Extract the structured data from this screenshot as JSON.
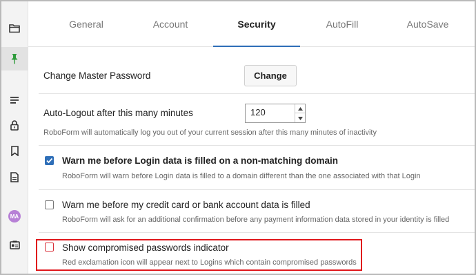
{
  "sidebar": {
    "items": [
      {
        "icon": "folder-icon"
      },
      {
        "icon": "pin-icon",
        "active": true
      },
      {
        "icon": "list-icon"
      },
      {
        "icon": "lock-icon"
      },
      {
        "icon": "bookmark-icon"
      },
      {
        "icon": "document-icon"
      },
      {
        "icon": "avatar",
        "initials": "MA"
      },
      {
        "icon": "id-card-icon"
      }
    ],
    "avatar_initials": "MA"
  },
  "tabs": [
    {
      "label": "General"
    },
    {
      "label": "Account"
    },
    {
      "label": "Security",
      "active": true
    },
    {
      "label": "AutoFill"
    },
    {
      "label": "AutoSave"
    }
  ],
  "settings": {
    "master_password": {
      "label": "Change Master Password",
      "button_label": "Change"
    },
    "auto_logout": {
      "label": "Auto-Logout after this many minutes",
      "value": "120",
      "description": "RoboForm will automatically log you out of your current session after this many minutes of inactivity"
    },
    "warn_login": {
      "label": "Warn me before Login data is filled on a non-matching domain",
      "checked": true,
      "description": "RoboForm will warn before Login data is filled to a domain different than the one associated with that Login"
    },
    "warn_payment": {
      "label": "Warn me before my credit card or bank account data is filled",
      "checked": false,
      "description": "RoboForm will ask for an additional confirmation before any payment information data stored in your identity is filled"
    },
    "compromised": {
      "label": "Show compromised passwords indicator",
      "checked": false,
      "description": "Red exclamation icon will appear next to Logins which contain compromised passwords"
    }
  },
  "colors": {
    "accent": "#2f6fb8",
    "highlight": "#e0171b",
    "pin_green": "#2e9b3b",
    "avatar": "#b780d6"
  }
}
